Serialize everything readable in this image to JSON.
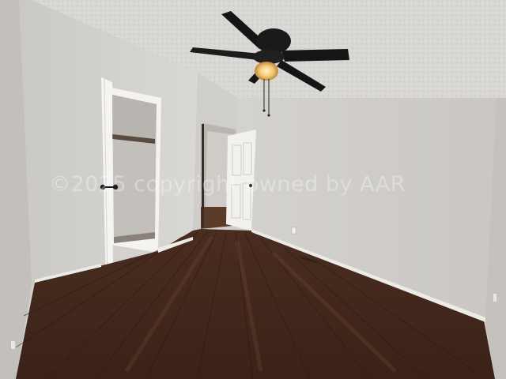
{
  "photo": {
    "subject": "empty bedroom",
    "watermark_text": "©2025 copyright owned by AAR",
    "colors": {
      "ceiling": "#d8d6d2",
      "wall_light": "#d2d0cd",
      "wall_shadow": "#bfbcb8",
      "floor_dark": "#3b2319",
      "floor_light": "#5a3a2a",
      "fan_blade": "#151515",
      "fan_light": "#f0c36a"
    },
    "icons": [
      "ceiling-fan-icon",
      "door-knob-icon",
      "floor-vent-icon",
      "outlet-icon"
    ]
  }
}
